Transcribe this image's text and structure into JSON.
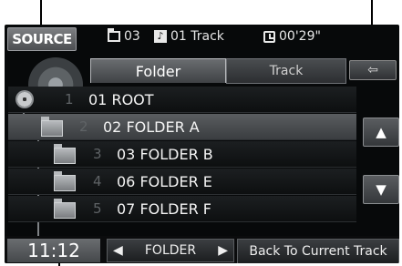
{
  "header": {
    "source_label": "SOURCE",
    "folder_count": "03",
    "track_label": "01 Track",
    "elapsed_time": "00'29\""
  },
  "tabs": {
    "folder": "Folder",
    "track": "Track"
  },
  "list": {
    "items": [
      {
        "number": "1",
        "name": "01 ROOT"
      },
      {
        "number": "2",
        "name": "02 FOLDER A"
      },
      {
        "number": "3",
        "name": "03 FOLDER B"
      },
      {
        "number": "4",
        "name": "06 FOLDER E"
      },
      {
        "number": "5",
        "name": "07 FOLDER F"
      }
    ],
    "selected_index": 1
  },
  "bottom": {
    "clock": "11:12",
    "folder_nav_label": "FOLDER",
    "back_label": "Back To Current Track"
  },
  "colors": {
    "screen_bg": "#07090a",
    "selected_row": "#4a4d50",
    "callout": "#000000"
  }
}
